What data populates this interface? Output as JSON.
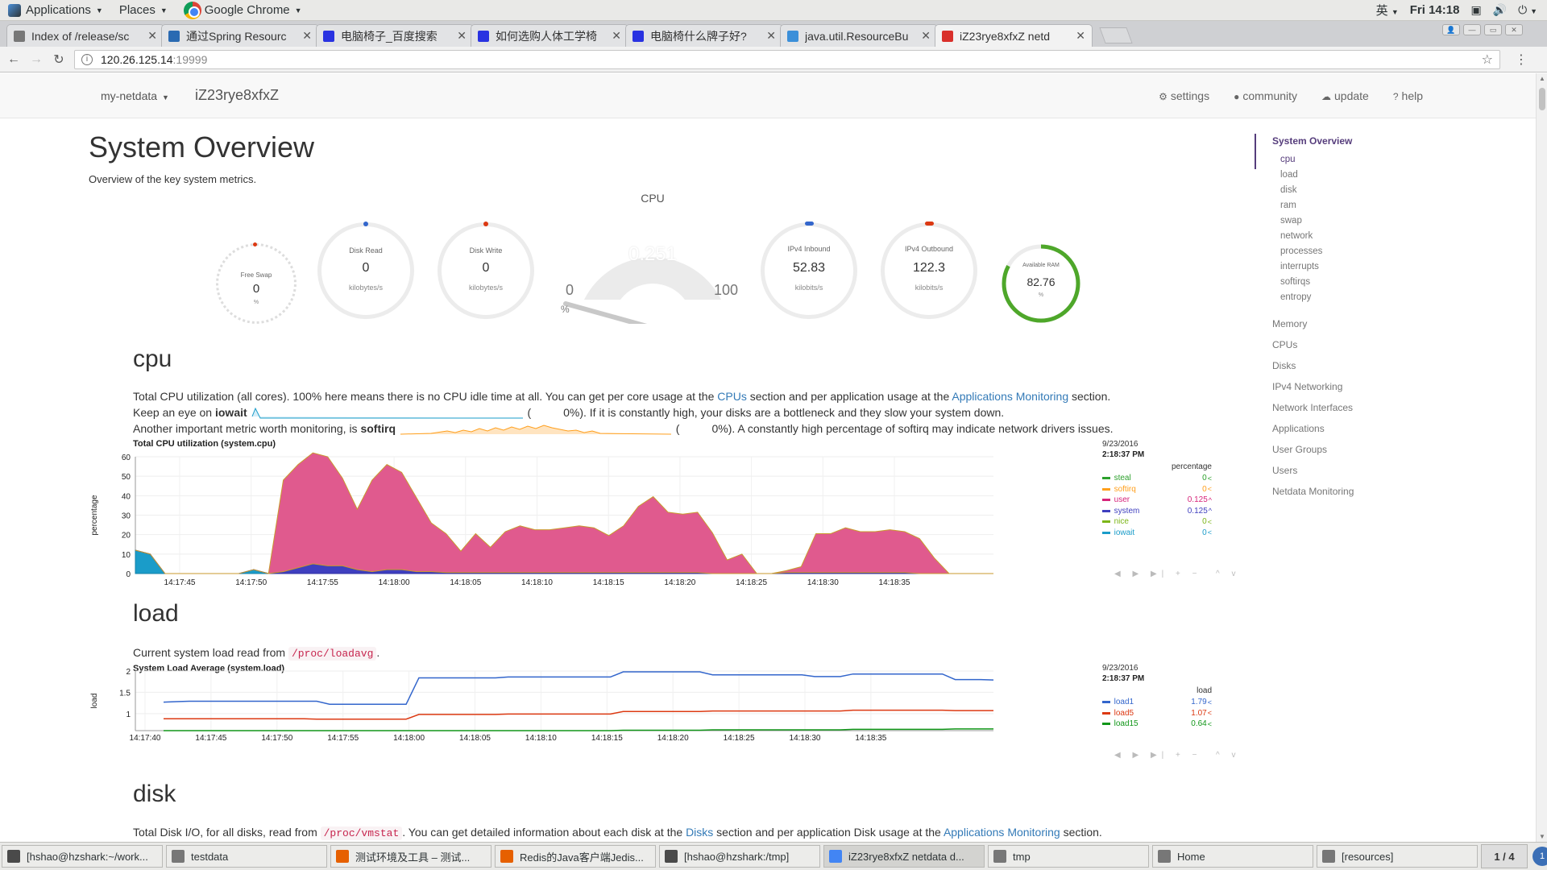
{
  "gnome": {
    "applications": "Applications",
    "places": "Places",
    "active_app": "Google Chrome",
    "input_method": "英",
    "clock": "Fri 14:18"
  },
  "tabs": [
    {
      "title": "Index of /release/sc",
      "icon": "folder-icon",
      "color": "#777777"
    },
    {
      "title": "通过Spring Resourc",
      "icon": "page-icon",
      "color": "#2a6ab2"
    },
    {
      "title": "电脑椅子_百度搜索",
      "icon": "baidu-paw-icon",
      "color": "#2932e1"
    },
    {
      "title": "如何选购人体工学椅",
      "icon": "baidu-paw-icon",
      "color": "#2932e1"
    },
    {
      "title": "电脑椅什么牌子好?",
      "icon": "baidu-paw-icon",
      "color": "#2932e1"
    },
    {
      "title": "java.util.ResourceBu",
      "icon": "j-icon",
      "color": "#3b8fd9"
    },
    {
      "title": "iZ23rye8xfxZ netd",
      "icon": "netdata-icon",
      "color": "#d9302b"
    }
  ],
  "address": {
    "host": "120.26.125.14",
    "port": ":19999"
  },
  "netdata_nav": {
    "brand": "my-netdata",
    "hostname": "iZ23rye8xfxZ",
    "links": [
      "settings",
      "community",
      "update",
      "help"
    ]
  },
  "overview": {
    "title": "System Overview",
    "subtitle": "Overview of the key system metrics."
  },
  "gauges": {
    "free_swap": {
      "label": "Free Swap",
      "value": "0",
      "unit": "%"
    },
    "disk_read": {
      "label": "Disk Read",
      "value": "0",
      "unit": "kilobytes/s"
    },
    "disk_write": {
      "label": "Disk Write",
      "value": "0",
      "unit": "kilobytes/s"
    },
    "cpu": {
      "label": "CPU",
      "value": "0.251",
      "min": "0",
      "max": "100",
      "unit": "%",
      "percent": 0.251
    },
    "ipv4_in": {
      "label": "IPv4 Inbound",
      "value": "52.83",
      "unit": "kilobits/s"
    },
    "ipv4_out": {
      "label": "IPv4 Outbound",
      "value": "122.3",
      "unit": "kilobits/s"
    },
    "ram": {
      "label": "Available RAM",
      "value": "82.76",
      "unit": "%",
      "percent": 82.76
    }
  },
  "cpu_section": {
    "heading": "cpu",
    "p1_a": "Total CPU utilization (all cores). 100% here means there is no CPU idle time at all. You can get per core usage at the ",
    "p1_link1": "CPUs",
    "p1_b": " section and per application usage at the ",
    "p1_link2": "Applications Monitoring",
    "p1_c": " section.",
    "p2_a": "Keep an eye on ",
    "p2_b": "iowait",
    "p2_c": "0%). If it is constantly high, your disks are a bottleneck and they slow your system down.",
    "p3_a": "Another important metric worth monitoring, is ",
    "p3_b": "softirq",
    "p3_c": "0%). A constantly high percentage of softirq may indicate network drivers issues.",
    "paren_open": "(",
    "chart_title": "Total CPU utilization (system.cpu)",
    "ylabel": "percentage",
    "date": "9/23/2016",
    "time": "2:18:37 PM",
    "units": "percentage",
    "legend": [
      {
        "name": "steal",
        "value": "0",
        "color": "#2ca02c"
      },
      {
        "name": "softirq",
        "value": "0",
        "color": "#ff9f1c"
      },
      {
        "name": "user",
        "value": "0.125",
        "color": "#d6247a"
      },
      {
        "name": "system",
        "value": "0.125",
        "color": "#3f3fbf"
      },
      {
        "name": "nice",
        "value": "0",
        "color": "#7cb518"
      },
      {
        "name": "iowait",
        "value": "0",
        "color": "#1a9cc9"
      }
    ],
    "trend_up": "^",
    "trend_flat": "<"
  },
  "load_section": {
    "heading": "load",
    "p1_a": "Current system load read from ",
    "p1_code": "/proc/loadavg",
    "p1_b": ".",
    "chart_title": "System Load Average (system.load)",
    "ylabel": "load",
    "date": "9/23/2016",
    "time": "2:18:37 PM",
    "units": "load",
    "legend": [
      {
        "name": "load1",
        "value": "1.79",
        "color": "#3366cc"
      },
      {
        "name": "load5",
        "value": "1.07",
        "color": "#dc3912"
      },
      {
        "name": "load15",
        "value": "0.64",
        "color": "#109618"
      }
    ],
    "trend": "<"
  },
  "disk_section": {
    "heading": "disk",
    "p1_a": "Total Disk I/O, for all disks, read from ",
    "p1_code": "/proc/vmstat",
    "p1_b": ". You can get detailed information about each disk at the ",
    "p1_link1": "Disks",
    "p1_c": " section and per application Disk usage at the ",
    "p1_link2": "Applications Monitoring",
    "p1_d": " section."
  },
  "chart_data": [
    {
      "type": "area",
      "title": "Total CPU utilization (system.cpu)",
      "ylabel": "percentage",
      "ylim": [
        0,
        60
      ],
      "yticks": [
        0,
        10,
        20,
        30,
        40,
        50,
        60
      ],
      "xticks": [
        "14:17:45",
        "14:17:50",
        "14:17:55",
        "14:18:00",
        "14:18:05",
        "14:18:10",
        "14:18:15",
        "14:18:20",
        "14:18:25",
        "14:18:30",
        "14:18:35"
      ],
      "x": [
        0,
        1,
        2,
        3,
        4,
        5,
        6,
        7,
        8,
        9,
        10,
        11,
        12,
        13,
        14,
        15,
        16,
        17,
        18,
        19,
        20,
        21,
        22,
        23,
        24,
        25,
        26,
        27,
        28,
        29,
        30,
        31,
        32,
        33,
        34,
        35,
        36,
        37,
        38,
        39,
        40,
        41,
        42,
        43,
        44,
        45,
        46,
        47,
        48,
        49,
        50,
        51,
        52,
        53,
        54,
        55,
        56,
        57,
        58
      ],
      "series": [
        {
          "name": "iowait",
          "values": [
            12,
            10,
            0,
            0,
            0,
            0,
            0,
            0,
            2,
            0,
            0,
            0,
            0,
            0,
            0,
            0,
            0,
            0,
            0,
            0,
            0,
            0,
            0,
            0,
            0,
            0,
            0,
            0,
            0,
            0,
            0,
            0,
            0,
            0,
            0,
            0,
            0,
            0,
            0,
            0,
            0,
            0,
            0,
            0,
            0,
            0,
            0,
            0,
            0,
            0,
            0,
            0,
            0,
            0,
            0,
            0,
            0,
            0,
            0
          ]
        },
        {
          "name": "system",
          "values": [
            0,
            0,
            0,
            0,
            0,
            0,
            0,
            0,
            0,
            0,
            1,
            3,
            5,
            4,
            4,
            2,
            1,
            2,
            2,
            1,
            1,
            0.5,
            0.5,
            0.5,
            0.5,
            0.5,
            0.5,
            0.5,
            0.5,
            0.5,
            0.5,
            0.5,
            0.5,
            0.5,
            0.5,
            0.5,
            0.5,
            0.5,
            0.5,
            0,
            0,
            0,
            0,
            0,
            0.5,
            0.5,
            0.5,
            0.5,
            0.5,
            0.5,
            0.5,
            0.5,
            0.5,
            0,
            0,
            0,
            0,
            0,
            0
          ]
        },
        {
          "name": "user",
          "values": [
            0,
            0,
            0,
            0,
            0,
            0,
            0,
            0,
            0,
            0,
            47,
            53,
            57,
            56,
            45,
            31,
            47,
            54,
            50,
            38,
            25,
            20,
            11,
            20,
            13,
            21,
            24,
            22,
            22,
            23,
            24,
            23,
            19,
            24,
            34,
            39,
            31,
            30,
            31,
            21,
            7,
            10,
            0,
            0,
            1,
            3,
            20,
            20,
            23,
            21,
            21,
            22,
            21,
            18,
            8,
            0,
            0,
            0,
            0
          ]
        }
      ]
    },
    {
      "type": "line",
      "title": "System Load Average (system.load)",
      "ylabel": "load",
      "ylim": [
        0.6,
        2
      ],
      "yticks": [
        1,
        1.5,
        2
      ],
      "xticks": [
        "14:17:40",
        "14:17:45",
        "14:17:50",
        "14:17:55",
        "14:18:00",
        "14:18:05",
        "14:18:10",
        "14:18:15",
        "14:18:20",
        "14:18:25",
        "14:18:30",
        "14:18:35"
      ],
      "x": [
        0,
        1,
        2,
        3,
        4,
        5,
        6,
        7,
        8,
        9,
        10,
        11,
        12,
        13,
        14,
        15,
        16,
        17,
        18,
        19,
        20,
        21,
        22,
        23,
        24,
        25,
        26,
        27,
        28,
        29,
        30,
        31,
        32,
        33,
        34,
        35,
        36,
        37,
        38,
        39,
        40,
        41,
        42,
        43,
        44,
        45,
        46,
        47,
        48,
        49,
        50,
        51,
        52,
        53,
        54,
        55,
        56,
        57,
        58,
        59,
        60,
        61,
        62,
        63,
        64,
        65
      ],
      "series": [
        {
          "name": "load1",
          "values": [
            1.27,
            1.28,
            1.29,
            1.29,
            1.29,
            1.29,
            1.29,
            1.29,
            1.29,
            1.29,
            1.29,
            1.29,
            1.29,
            1.22,
            1.22,
            1.22,
            1.22,
            1.22,
            1.22,
            1.22,
            1.84,
            1.84,
            1.84,
            1.84,
            1.84,
            1.84,
            1.84,
            1.86,
            1.86,
            1.86,
            1.86,
            1.86,
            1.86,
            1.86,
            1.86,
            1.86,
            1.98,
            1.98,
            1.98,
            1.98,
            1.98,
            1.98,
            1.98,
            1.91,
            1.91,
            1.91,
            1.91,
            1.91,
            1.91,
            1.91,
            1.91,
            1.87,
            1.87,
            1.87,
            1.93,
            1.93,
            1.93,
            1.93,
            1.93,
            1.93,
            1.93,
            1.93,
            1.8,
            1.8,
            1.8,
            1.79
          ]
        },
        {
          "name": "load5",
          "values": [
            0.88,
            0.88,
            0.88,
            0.88,
            0.88,
            0.88,
            0.88,
            0.88,
            0.88,
            0.88,
            0.88,
            0.88,
            0.87,
            0.87,
            0.87,
            0.87,
            0.87,
            0.87,
            0.87,
            0.87,
            0.98,
            0.98,
            0.98,
            0.98,
            0.98,
            0.98,
            0.98,
            0.99,
            0.99,
            0.99,
            0.99,
            0.99,
            0.99,
            0.99,
            0.99,
            0.99,
            1.05,
            1.05,
            1.05,
            1.05,
            1.05,
            1.05,
            1.05,
            1.06,
            1.06,
            1.06,
            1.06,
            1.06,
            1.06,
            1.06,
            1.06,
            1.06,
            1.06,
            1.06,
            1.08,
            1.08,
            1.08,
            1.08,
            1.08,
            1.08,
            1.08,
            1.08,
            1.07,
            1.07,
            1.07,
            1.07
          ]
        },
        {
          "name": "load15",
          "values": [
            0.55,
            0.55,
            0.55,
            0.55,
            0.55,
            0.55,
            0.55,
            0.55,
            0.55,
            0.55,
            0.55,
            0.55,
            0.55,
            0.55,
            0.55,
            0.55,
            0.55,
            0.55,
            0.55,
            0.55,
            0.58,
            0.58,
            0.58,
            0.58,
            0.58,
            0.58,
            0.58,
            0.59,
            0.59,
            0.59,
            0.59,
            0.59,
            0.59,
            0.59,
            0.59,
            0.59,
            0.61,
            0.61,
            0.61,
            0.61,
            0.61,
            0.61,
            0.61,
            0.62,
            0.62,
            0.62,
            0.62,
            0.62,
            0.62,
            0.62,
            0.62,
            0.62,
            0.62,
            0.62,
            0.63,
            0.63,
            0.63,
            0.63,
            0.63,
            0.63,
            0.63,
            0.63,
            0.64,
            0.64,
            0.64,
            0.64
          ]
        }
      ]
    }
  ],
  "sidebar": {
    "title": "System Overview",
    "sub": [
      "cpu",
      "load",
      "disk",
      "ram",
      "swap",
      "network",
      "processes",
      "interrupts",
      "softirqs",
      "entropy"
    ],
    "items": [
      "Memory",
      "CPUs",
      "Disks",
      "IPv4 Networking",
      "Network Interfaces",
      "Applications",
      "User Groups",
      "Users",
      "Netdata Monitoring"
    ]
  },
  "taskbar": {
    "tasks": [
      {
        "label": "[hshao@hzshark:~/work...",
        "icon": "terminal-icon",
        "color": "#4a4a4a"
      },
      {
        "label": "testdata",
        "icon": "folder-icon",
        "color": "#777777"
      },
      {
        "label": "测试环境及工具 – 测试...",
        "icon": "firefox-icon",
        "color": "#e66000"
      },
      {
        "label": "Redis的Java客户端Jedis...",
        "icon": "firefox-icon",
        "color": "#e66000"
      },
      {
        "label": "[hshao@hzshark:/tmp]",
        "icon": "terminal-icon",
        "color": "#4a4a4a"
      },
      {
        "label": "iZ23rye8xfxZ netdata d...",
        "icon": "chrome-icon",
        "color": "#4285f4"
      },
      {
        "label": "tmp",
        "icon": "folder-icon",
        "color": "#777777"
      },
      {
        "label": "Home",
        "icon": "folder-icon",
        "color": "#777777"
      },
      {
        "label": "[resources]",
        "icon": "folder-icon",
        "color": "#777777"
      }
    ],
    "pager": "1 / 4",
    "notify": "1"
  }
}
